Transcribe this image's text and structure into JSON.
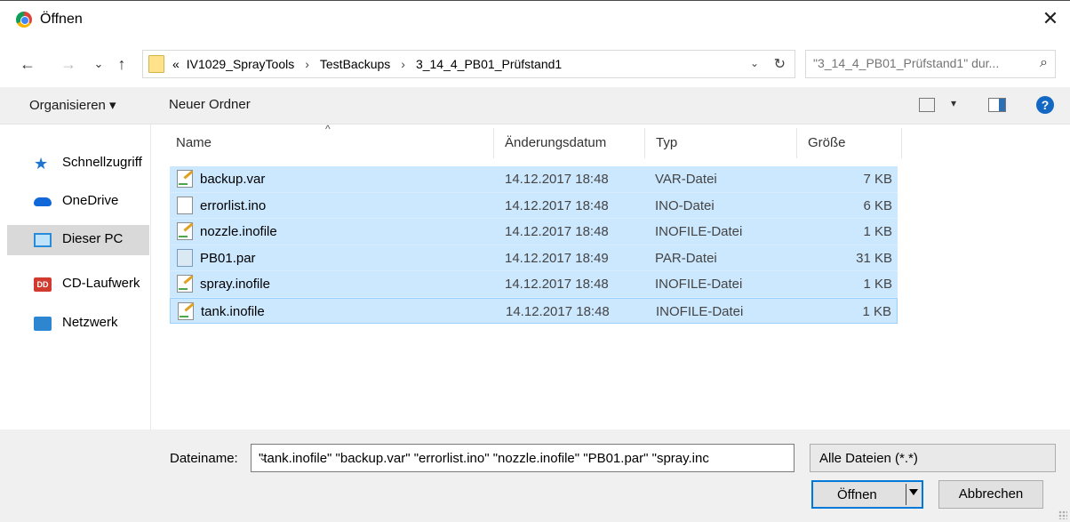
{
  "window": {
    "title": "Öffnen",
    "close_glyph": "✕"
  },
  "nav_buttons": {
    "back": "←",
    "forward": "→",
    "recent": "⌄",
    "up": "↑"
  },
  "address": {
    "prefix": "«",
    "crumbs": [
      "IV1029_SprayTools",
      "TestBackups",
      "3_14_4_PB01_Prüfstand1"
    ],
    "separator": "›",
    "dropdown_glyph": "⌄",
    "refresh_glyph": "↻"
  },
  "search": {
    "placeholder": "\"3_14_4_PB01_Prüfstand1\" dur...",
    "icon": "search-icon"
  },
  "commandbar": {
    "organize": "Organisieren ▾",
    "new_folder": "Neuer Ordner",
    "view_dropdown": "▾",
    "help": "?"
  },
  "nav_pane": [
    {
      "label": "Schnellzugriff",
      "icon": "star-icon",
      "selected": false
    },
    {
      "label": "OneDrive",
      "icon": "cloud-icon",
      "selected": false
    },
    {
      "label": "Dieser PC",
      "icon": "computer-icon",
      "selected": true
    },
    {
      "label": "CD-Laufwerk",
      "icon": "cd-drive-icon",
      "selected": false
    },
    {
      "label": "Netzwerk",
      "icon": "network-icon",
      "selected": false
    }
  ],
  "columns": {
    "name": "Name",
    "date": "Änderungsdatum",
    "type": "Typ",
    "size": "Größe",
    "sort_glyph": "^"
  },
  "files": [
    {
      "name": "backup.var",
      "date": "14.12.2017 18:48",
      "type": "VAR-Datei",
      "size": "7 KB",
      "icon": "edit-file-icon"
    },
    {
      "name": "errorlist.ino",
      "date": "14.12.2017 18:48",
      "type": "INO-Datei",
      "size": "6 KB",
      "icon": "blank-file-icon"
    },
    {
      "name": "nozzle.inofile",
      "date": "14.12.2017 18:48",
      "type": "INOFILE-Datei",
      "size": "1 KB",
      "icon": "edit-file-icon"
    },
    {
      "name": "PB01.par",
      "date": "14.12.2017 18:49",
      "type": "PAR-Datei",
      "size": "31 KB",
      "icon": "par-file-icon"
    },
    {
      "name": "spray.inofile",
      "date": "14.12.2017 18:48",
      "type": "INOFILE-Datei",
      "size": "1 KB",
      "icon": "edit-file-icon"
    },
    {
      "name": "tank.inofile",
      "date": "14.12.2017 18:48",
      "type": "INOFILE-Datei",
      "size": "1 KB",
      "icon": "edit-file-icon"
    }
  ],
  "footer": {
    "filename_label": "Dateiname:",
    "filename_value": "\"tank.inofile\" \"backup.var\" \"errorlist.ino\" \"nozzle.inofile\" \"PB01.par\" \"spray.inc",
    "filetype_value": "Alle Dateien (*.*)",
    "dropdown_glyph": "⌄",
    "open_label": "Öffnen",
    "cancel_label": "Abbrechen"
  },
  "colors": {
    "selection": "#cce8ff",
    "selection_border": "#99d1ff",
    "accent": "#0078d7",
    "chrome": "#f0f0f0"
  }
}
